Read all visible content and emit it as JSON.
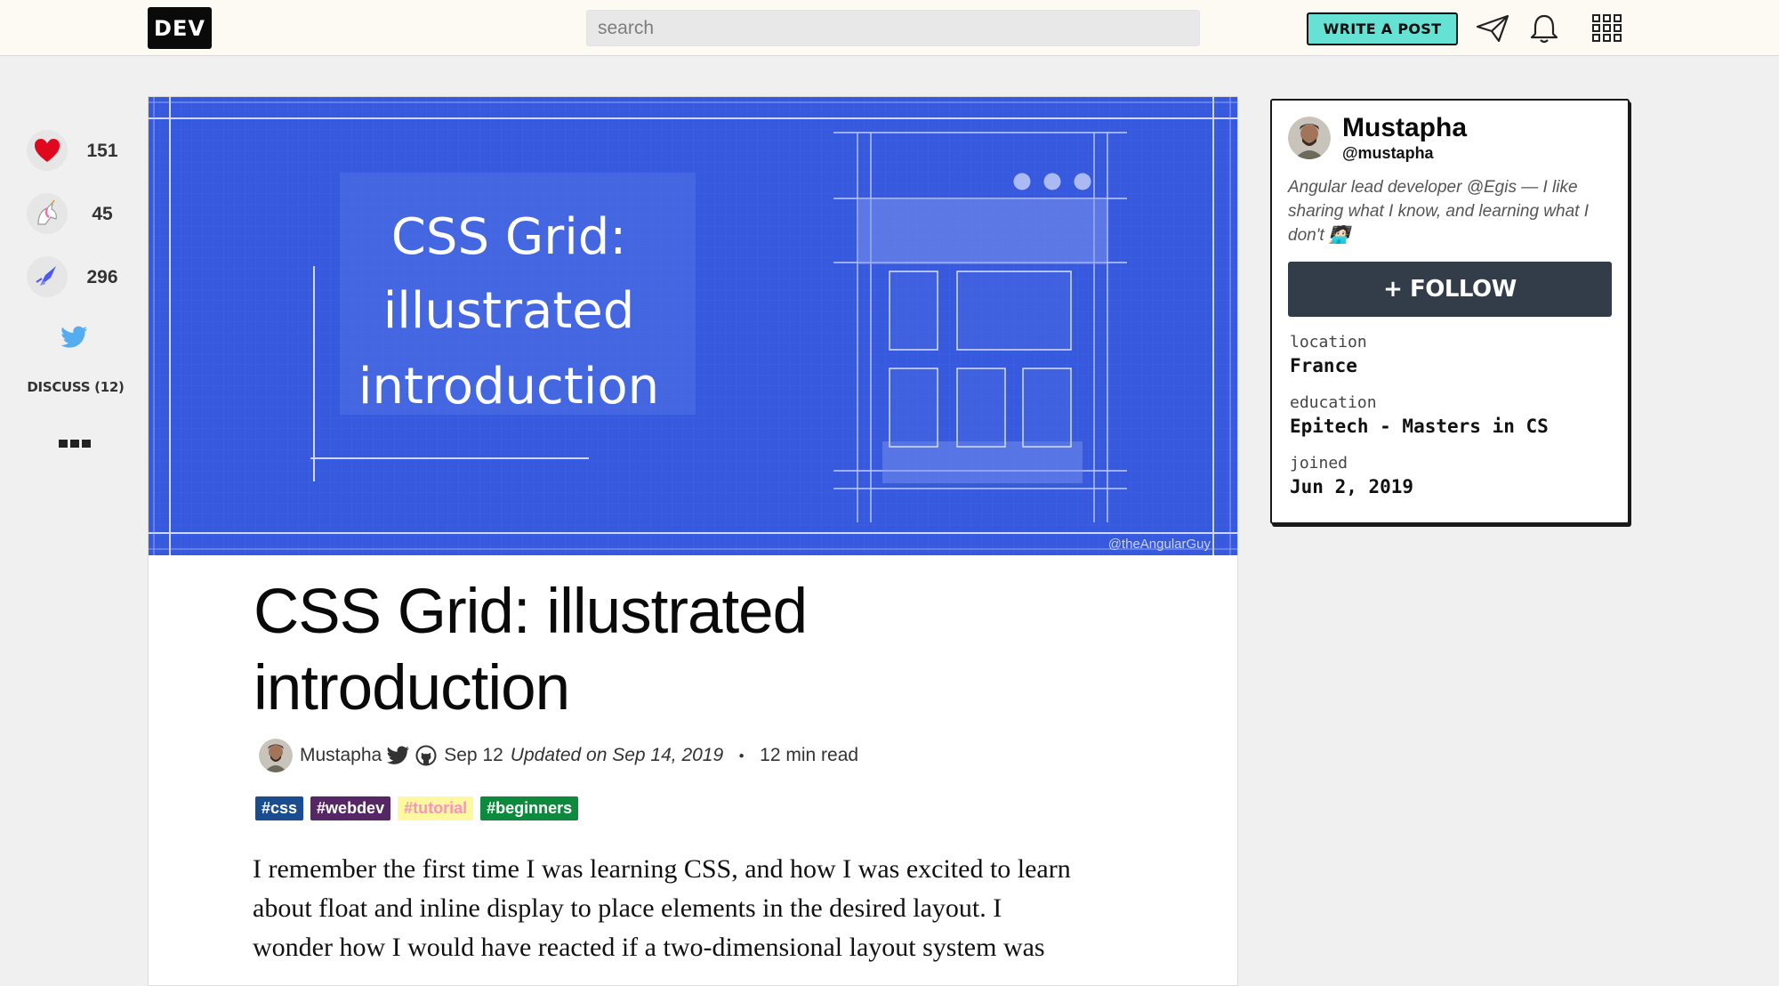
{
  "header": {
    "logo": "DEV",
    "search_placeholder": "search",
    "write_post_label": "WRITE A POST",
    "icons": [
      "paper-plane-icon",
      "bell-icon",
      "grid-menu-icon"
    ]
  },
  "sidebar": {
    "reactions": [
      {
        "name": "heart",
        "count": "151",
        "color": "#e0081f"
      },
      {
        "name": "unicorn",
        "count": "45",
        "color": "#f5a0c8"
      },
      {
        "name": "bookmark",
        "count": "296",
        "color": "#4b59f5"
      }
    ],
    "discuss_label": "DISCUSS (12)"
  },
  "cover": {
    "title_lines": [
      "CSS Grid:",
      "illustrated",
      "introduction"
    ],
    "watermark": "@theAngularGuy",
    "background": "#3759dd"
  },
  "article": {
    "title": "CSS Grid: illustrated introduction",
    "author": "Mustapha",
    "date": "Sep 12",
    "updated": "Updated on Sep 14, 2019",
    "separator": "・",
    "read_time": "12 min read",
    "tags": [
      {
        "label": "#css",
        "bg": "#1a4d8f",
        "fg": "#ffffff"
      },
      {
        "label": "#webdev",
        "bg": "#562765",
        "fg": "#ffffff"
      },
      {
        "label": "#tutorial",
        "bg": "#fef8a0",
        "fg": "#ff92c0"
      },
      {
        "label": "#beginners",
        "bg": "#0e8a3e",
        "fg": "#ffffff"
      }
    ],
    "body_lines": [
      "I remember the first time I was learning CSS, and how I was excited to learn",
      "about float and inline display to place elements in the desired layout. I",
      "wonder how I would have reacted if a two-dimensional layout system was"
    ]
  },
  "profile": {
    "name": "Mustapha",
    "handle": "@mustapha",
    "bio": "Angular lead developer @Egis — I like sharing what I know, and learning what I don't 🧑🏻‍💻",
    "follow_label": "+ FOLLOW",
    "fields": [
      {
        "key": "location",
        "value": "France"
      },
      {
        "key": "education",
        "value": "Epitech - Masters in CS"
      },
      {
        "key": "joined",
        "value": "Jun 2, 2019"
      }
    ]
  }
}
